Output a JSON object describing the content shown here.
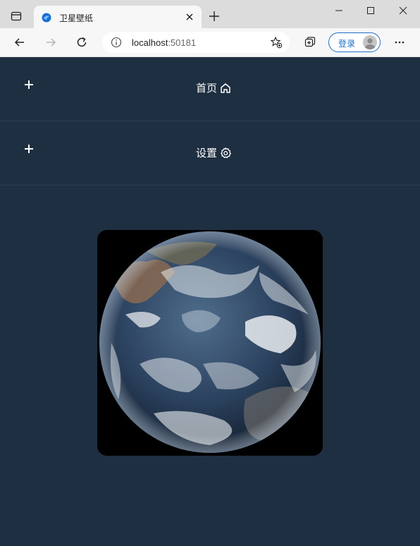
{
  "browser": {
    "tab_title": "卫星壁纸",
    "address_host": "localhost",
    "address_port": ":50181",
    "login_label": "登录"
  },
  "nav": {
    "items": [
      {
        "label": "首页",
        "icon": "home-icon"
      },
      {
        "label": "设置",
        "icon": "gear-icon"
      }
    ]
  },
  "image": {
    "subject": "earth-satellite-image"
  },
  "colors": {
    "page_background": "#1e2f42",
    "divider": "#2d4053",
    "accent": "#1f6fc6"
  }
}
